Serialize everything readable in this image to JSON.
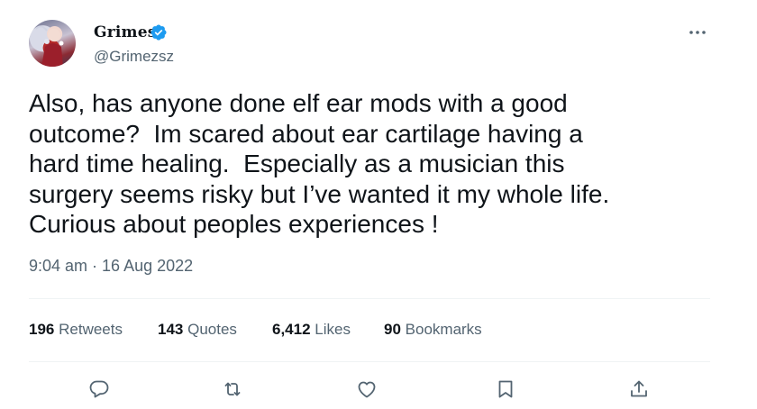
{
  "author": {
    "name": "Grimes",
    "handle": "@Grimezsz",
    "verified_icon": "verified-badge-icon",
    "verified_color": "#1d9bf0"
  },
  "more_icon": "more-options-icon",
  "tweet": {
    "text": "Also, has anyone done elf ear mods with a good\noutcome?  Im scared about ear cartilage having a\nhard time healing.  Especially as a musician this\nsurgery seems risky but I’ve wanted it my whole life.\nCurious about peoples experiences !",
    "timestamp": "9:04 am · 16 Aug 2022"
  },
  "stats": {
    "retweets_count": "196",
    "retweets_label": "Retweets",
    "quotes_count": "143",
    "quotes_label": "Quotes",
    "likes_count": "6,412",
    "likes_label": "Likes",
    "bookmarks_count": "90",
    "bookmarks_label": "Bookmarks"
  },
  "actions": [
    "reply-icon",
    "retweet-icon",
    "like-icon",
    "bookmark-icon",
    "share-icon"
  ],
  "colors": {
    "text": "#0f1419",
    "secondary": "#536471",
    "divider": "#eff3f4"
  }
}
